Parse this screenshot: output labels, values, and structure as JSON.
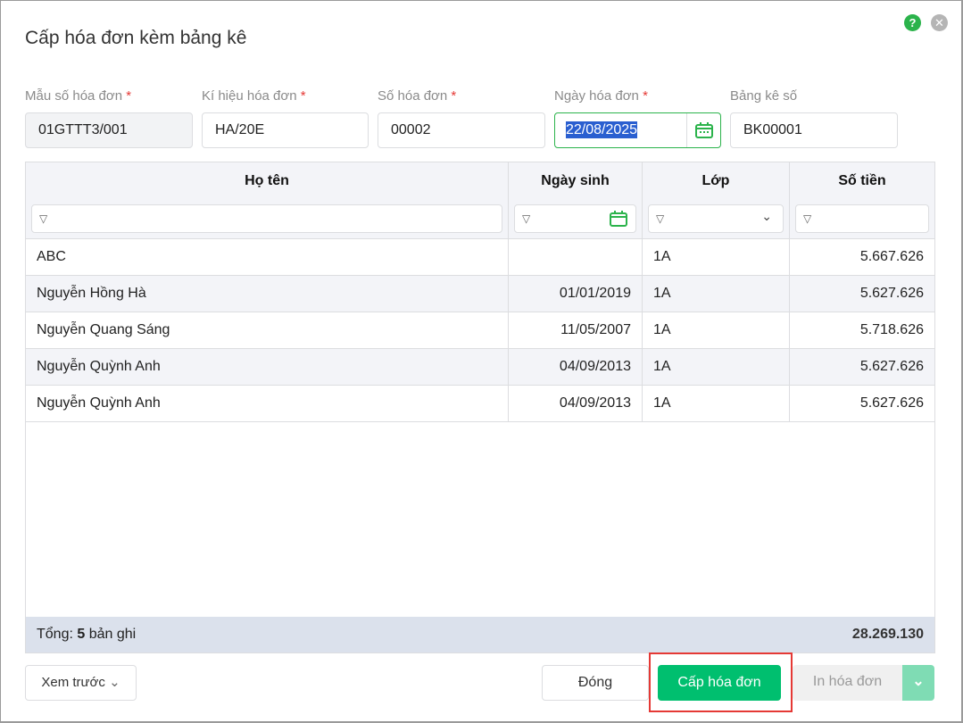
{
  "dialog": {
    "title": "Cấp hóa đơn kèm bảng kê",
    "help_icon": "?",
    "close_icon": "✕"
  },
  "form": {
    "mau_so": {
      "label": "Mẫu số hóa đơn",
      "required": "*",
      "value": "01GTTT3/001"
    },
    "ki_hieu": {
      "label": "Kí hiệu hóa đơn",
      "required": "*",
      "value": "HA/20E"
    },
    "so_hd": {
      "label": "Số hóa đơn",
      "required": "*",
      "value": "00002"
    },
    "ngay_hd": {
      "label": "Ngày hóa đơn",
      "required": "*",
      "value": "22/08/2025"
    },
    "bang_ke": {
      "label": "Bảng kê số",
      "value": "BK00001"
    }
  },
  "table": {
    "columns": [
      "Họ tên",
      "Ngày sinh",
      "Lớp",
      "Số tiền"
    ],
    "rows": [
      {
        "name": "ABC",
        "dob": "",
        "class": "1A",
        "amount": "5.667.626"
      },
      {
        "name": "Nguyễn Hồng Hà",
        "dob": "01/01/2019",
        "class": "1A",
        "amount": "5.627.626"
      },
      {
        "name": "Nguyễn Quang Sáng",
        "dob": "11/05/2007",
        "class": "1A",
        "amount": "5.718.626"
      },
      {
        "name": "Nguyễn Quỳnh Anh",
        "dob": "04/09/2013",
        "class": "1A",
        "amount": "5.627.626"
      },
      {
        "name": "Nguyễn Quỳnh Anh",
        "dob": "04/09/2013",
        "class": "1A",
        "amount": "5.627.626"
      }
    ],
    "footer": {
      "label": "Tổng:",
      "count": "5",
      "suffix": "bản ghi",
      "total": "28.269.130"
    }
  },
  "buttons": {
    "preview": "Xem trước",
    "close": "Đóng",
    "issue": "Cấp hóa đơn",
    "print": "In hóa đơn"
  },
  "colors": {
    "primary": "#00bf6f",
    "highlight": "#e53935"
  }
}
